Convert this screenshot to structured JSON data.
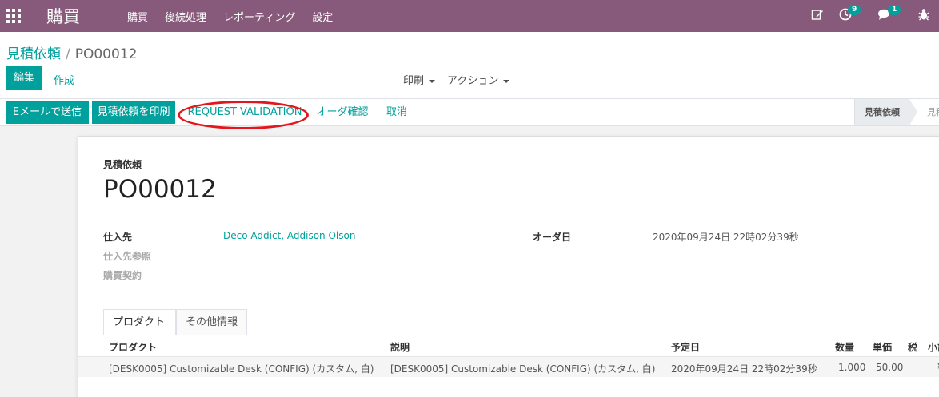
{
  "navbar": {
    "brand": "購買",
    "menu": [
      "購買",
      "後続処理",
      "レポーティング",
      "設定"
    ],
    "activity_badge": "9",
    "messages_badge": "1"
  },
  "breadcrumb": {
    "parent": "見積依頼",
    "separator": "/",
    "current": "PO00012"
  },
  "control": {
    "edit_label": "編集",
    "create_label": "作成",
    "print_label": "印刷",
    "action_label": "アクション"
  },
  "statusbar": {
    "send_email": "Eメールで送信",
    "print_rfq": "見積依頼を印刷",
    "request_validation": "REQUEST VALIDATION",
    "confirm_order": "オーダ確認",
    "cancel": "取消",
    "stage_current": "見積依頼",
    "stage_next": "見積"
  },
  "form": {
    "doc_type": "見積依頼",
    "doc_name": "PO00012",
    "vendor_label": "仕入先",
    "vendor_value": "Deco Addict, Addison Olson",
    "vendor_ref_label": "仕入先参照",
    "agreement_label": "購買契約",
    "order_date_label": "オーダ日",
    "order_date_value": "2020年09月24日 22時02分39秒"
  },
  "tabs": {
    "products": "プロダクト",
    "other_info": "その他情報"
  },
  "table": {
    "headers": {
      "product": "プロダクト",
      "description": "説明",
      "scheduled_date": "予定日",
      "quantity": "数量",
      "unit_price": "単価",
      "tax": "税",
      "subtotal": "小計"
    },
    "rows": [
      {
        "product": "[DESK0005] Customizable Desk (CONFIG) (カスタム, 白)",
        "description": "[DESK0005] Customizable Desk (CONFIG) (カスタム, 白)",
        "scheduled_date": "2020年09月24日 22時02分39秒",
        "quantity": "1.000",
        "unit_price": "50.00",
        "subtotal": "¥"
      }
    ]
  },
  "colors": {
    "navbar": "#875a7b",
    "accent": "#00a09d",
    "highlight": "#e3161d"
  }
}
